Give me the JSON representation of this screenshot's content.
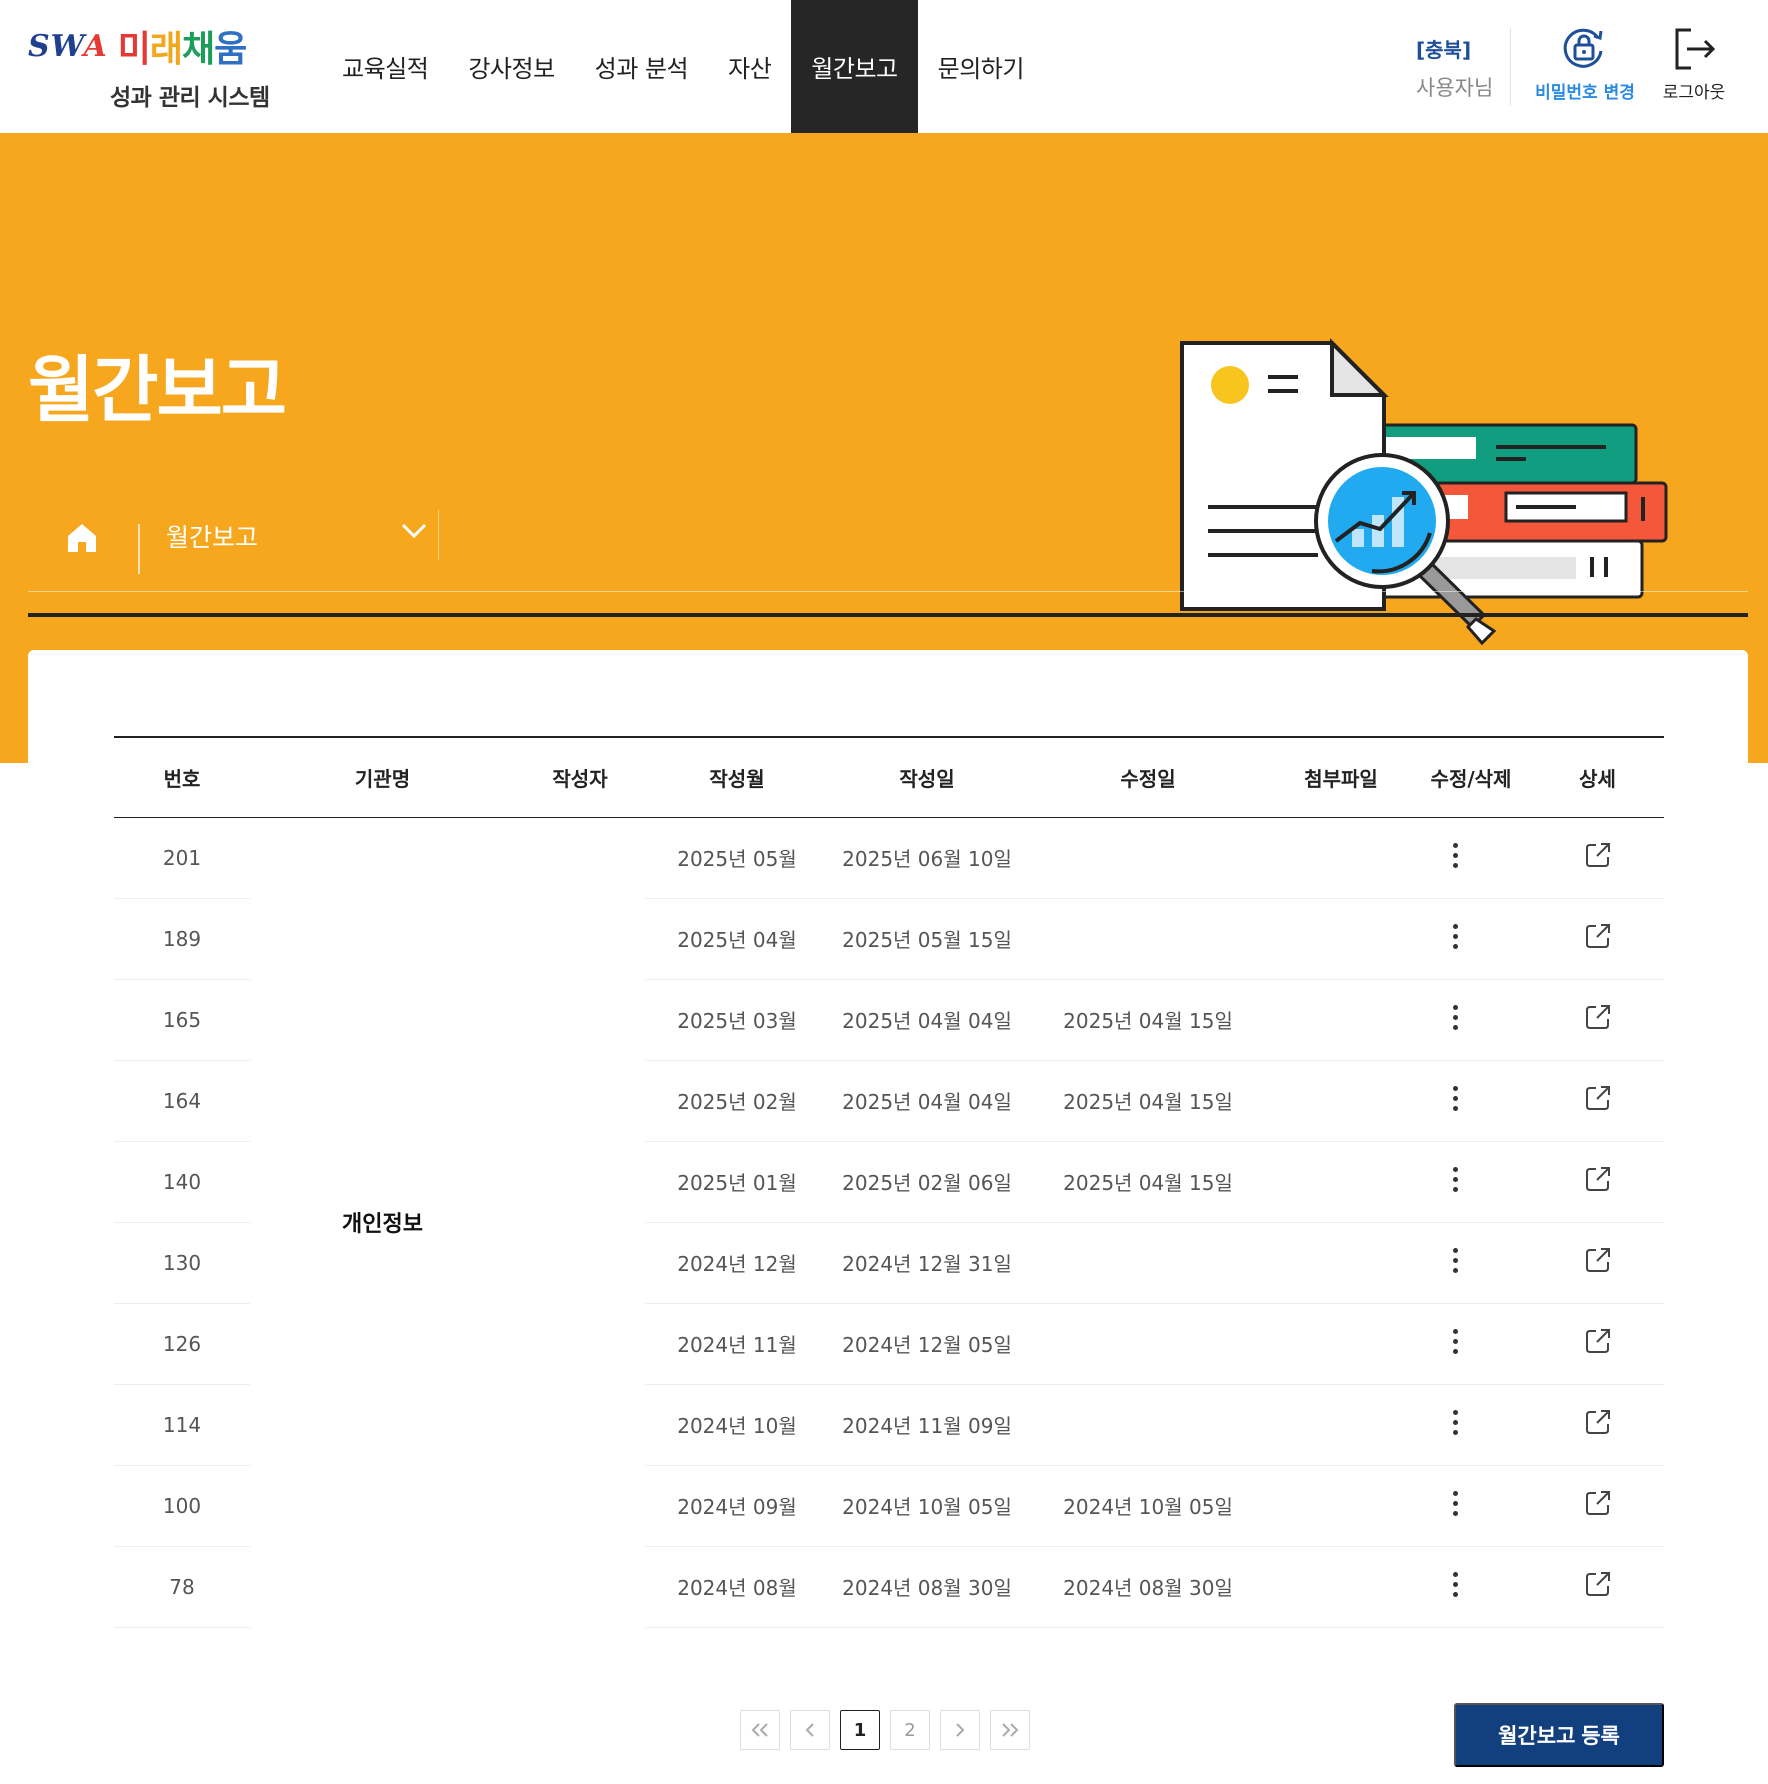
{
  "header": {
    "logo": {
      "brand": "SWA",
      "name": "미래채움",
      "subtitle": "성과 관리 시스템"
    },
    "nav": [
      {
        "label": "교육실적",
        "active": false
      },
      {
        "label": "강사정보",
        "active": false
      },
      {
        "label": "성과 분석",
        "active": false
      },
      {
        "label": "자산",
        "active": false
      },
      {
        "label": "월간보고",
        "active": true
      },
      {
        "label": "문의하기",
        "active": false
      }
    ],
    "user": {
      "region": "[충북]",
      "name": "사용자님"
    },
    "change_password_label": "비밀번호 변경",
    "logout_label": "로그아웃"
  },
  "banner": {
    "title": "월간보고",
    "breadcrumb": {
      "current": "월간보고"
    }
  },
  "table": {
    "columns": [
      "번호",
      "기관명",
      "작성자",
      "작성월",
      "작성일",
      "수정일",
      "첨부파일",
      "수정/삭제",
      "상세"
    ],
    "org_name": "개인정보",
    "rows": [
      {
        "no": "201",
        "month": "2025년 05월",
        "created": "2025년 06월 10일",
        "modified": ""
      },
      {
        "no": "189",
        "month": "2025년 04월",
        "created": "2025년 05월 15일",
        "modified": ""
      },
      {
        "no": "165",
        "month": "2025년 03월",
        "created": "2025년 04월 04일",
        "modified": "2025년 04월 15일"
      },
      {
        "no": "164",
        "month": "2025년 02월",
        "created": "2025년 04월 04일",
        "modified": "2025년 04월 15일"
      },
      {
        "no": "140",
        "month": "2025년 01월",
        "created": "2025년 02월 06일",
        "modified": "2025년 04월 15일"
      },
      {
        "no": "130",
        "month": "2024년 12월",
        "created": "2024년 12월 31일",
        "modified": ""
      },
      {
        "no": "126",
        "month": "2024년 11월",
        "created": "2024년 12월 05일",
        "modified": ""
      },
      {
        "no": "114",
        "month": "2024년 10월",
        "created": "2024년 11월 09일",
        "modified": ""
      },
      {
        "no": "100",
        "month": "2024년 09월",
        "created": "2024년 10월 05일",
        "modified": "2024년 10월 05일"
      },
      {
        "no": "78",
        "month": "2024년 08월",
        "created": "2024년 08월 30일",
        "modified": "2024년 08월 30일"
      }
    ]
  },
  "pagination": {
    "pages": [
      "1",
      "2"
    ],
    "current": "1"
  },
  "register_label": "월간보고 등록",
  "colors": {
    "accent": "#f7a71d",
    "nav_active": "#262626",
    "primary_button": "#123f7e",
    "link_blue": "#2b8be0"
  }
}
